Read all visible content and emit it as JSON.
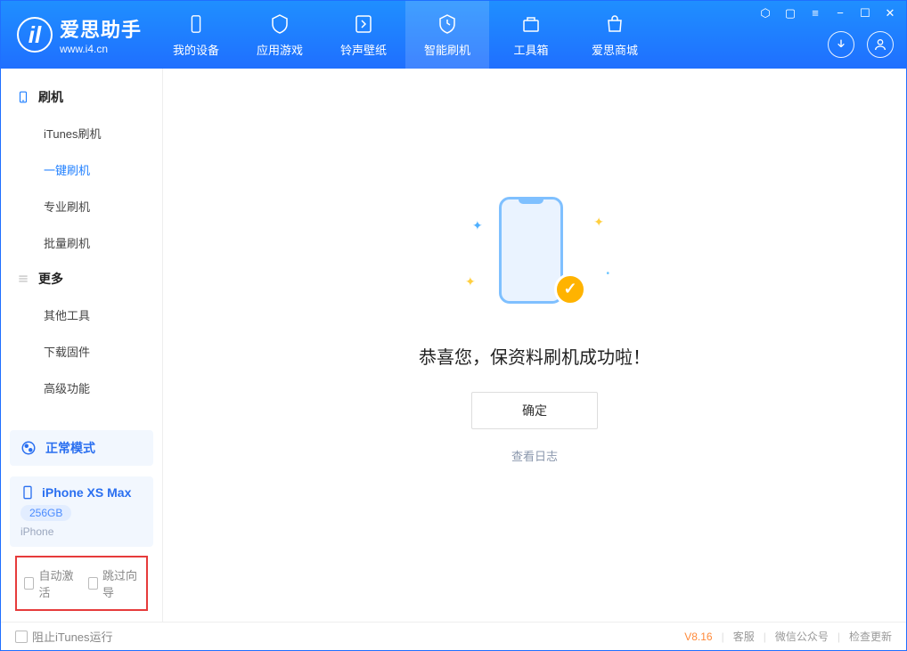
{
  "app": {
    "title": "爱思助手",
    "subtitle": "www.i4.cn"
  },
  "header_tabs": [
    {
      "label": "我的设备",
      "active": false
    },
    {
      "label": "应用游戏",
      "active": false
    },
    {
      "label": "铃声壁纸",
      "active": false
    },
    {
      "label": "智能刷机",
      "active": true
    },
    {
      "label": "工具箱",
      "active": false
    },
    {
      "label": "爱思商城",
      "active": false
    }
  ],
  "sidebar": {
    "section1_title": "刷机",
    "section1_items": [
      "iTunes刷机",
      "一键刷机",
      "专业刷机",
      "批量刷机"
    ],
    "section1_active_index": 1,
    "section2_title": "更多",
    "section2_items": [
      "其他工具",
      "下载固件",
      "高级功能"
    ]
  },
  "mode": {
    "label": "正常模式"
  },
  "device": {
    "name": "iPhone XS Max",
    "storage": "256GB",
    "type": "iPhone"
  },
  "options": {
    "auto_activate": "自动激活",
    "skip_guide": "跳过向导"
  },
  "main": {
    "success_msg": "恭喜您，保资料刷机成功啦！",
    "ok_btn": "确定",
    "view_log": "查看日志"
  },
  "footer": {
    "block_itunes": "阻止iTunes运行",
    "version": "V8.16",
    "links": [
      "客服",
      "微信公众号",
      "检查更新"
    ]
  }
}
